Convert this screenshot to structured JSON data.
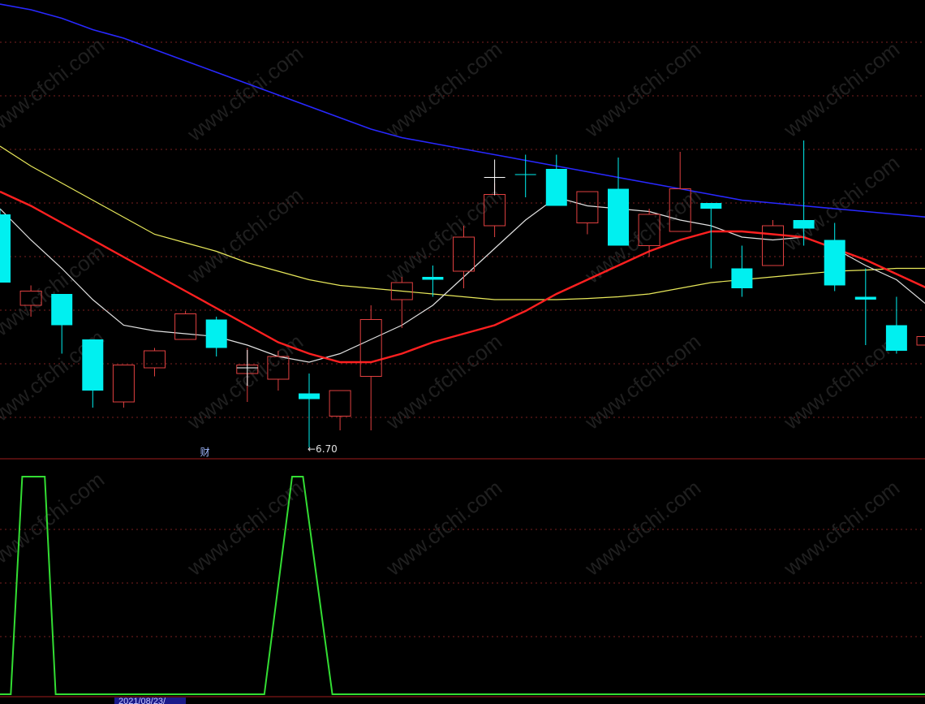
{
  "app": {
    "finance_marker": "财",
    "low_annotation": "←6.70",
    "date_label": "2021/08/23/",
    "watermark": "www.cfchi.com"
  },
  "colors": {
    "background": "#000000",
    "up_candle": "#e04040",
    "down_candle": "#00f0f0",
    "ma_white": "#e0e0e0",
    "ma_yellow": "#e8e85a",
    "ma_red": "#ff2020",
    "ma_blue": "#2828ff",
    "indicator": "#33dd33",
    "grid": "#7a1f1f",
    "divider": "#a01c1c"
  },
  "chart_data": [
    {
      "type": "candlestick",
      "panel": "price",
      "candles": [
        {
          "o": 10.8,
          "c": 9.6,
          "h": 10.9,
          "l": 9.6
        },
        {
          "o": 9.2,
          "c": 9.45,
          "h": 9.55,
          "l": 9.0
        },
        {
          "o": 9.4,
          "c": 8.85,
          "h": 9.4,
          "l": 8.35
        },
        {
          "o": 8.6,
          "c": 7.7,
          "h": 8.6,
          "l": 7.4
        },
        {
          "o": 7.5,
          "c": 8.15,
          "h": 8.15,
          "l": 7.4
        },
        {
          "o": 8.1,
          "c": 8.4,
          "h": 8.45,
          "l": 7.95
        },
        {
          "o": 8.6,
          "c": 9.05,
          "h": 9.1,
          "l": 8.6
        },
        {
          "o": 8.95,
          "c": 8.45,
          "h": 9.0,
          "l": 8.3
        },
        {
          "o": 8.0,
          "c": 8.15,
          "h": 8.45,
          "l": 7.5
        },
        {
          "o": 7.9,
          "c": 8.3,
          "h": 8.4,
          "l": 7.7
        },
        {
          "o": 7.65,
          "c": 7.55,
          "h": 8.0,
          "l": 6.7
        },
        {
          "o": 7.25,
          "c": 7.7,
          "h": 7.7,
          "l": 7.0
        },
        {
          "o": 7.95,
          "c": 8.95,
          "h": 9.2,
          "l": 7.0
        },
        {
          "o": 9.3,
          "c": 9.6,
          "h": 9.7,
          "l": 8.8
        },
        {
          "o": 9.7,
          "c": 9.65,
          "h": 9.9,
          "l": 9.35
        },
        {
          "o": 9.8,
          "c": 10.4,
          "h": 10.6,
          "l": 9.5
        },
        {
          "o": 10.6,
          "c": 11.15,
          "h": 11.35,
          "l": 10.4
        },
        {
          "o": 11.5,
          "c": 11.5,
          "h": 11.85,
          "l": 11.1
        },
        {
          "o": 11.6,
          "c": 10.95,
          "h": 11.85,
          "l": 10.95
        },
        {
          "o": 10.65,
          "c": 11.2,
          "h": 11.2,
          "l": 10.45
        },
        {
          "o": 11.25,
          "c": 10.25,
          "h": 11.8,
          "l": 10.25
        },
        {
          "o": 10.25,
          "c": 10.8,
          "h": 10.9,
          "l": 10.05
        },
        {
          "o": 10.5,
          "c": 11.25,
          "h": 11.9,
          "l": 10.5
        },
        {
          "o": 11.0,
          "c": 10.9,
          "h": 11.0,
          "l": 9.85
        },
        {
          "o": 9.85,
          "c": 9.5,
          "h": 10.25,
          "l": 9.35
        },
        {
          "o": 9.9,
          "c": 10.6,
          "h": 10.7,
          "l": 9.9
        },
        {
          "o": 10.7,
          "c": 10.55,
          "h": 12.1,
          "l": 10.25
        },
        {
          "o": 10.35,
          "c": 9.55,
          "h": 10.65,
          "l": 9.45
        },
        {
          "o": 9.35,
          "c": 9.3,
          "h": 9.85,
          "l": 8.5
        },
        {
          "o": 8.85,
          "c": 8.4,
          "h": 9.35,
          "l": 8.35
        },
        {
          "o": 8.5,
          "c": 8.65,
          "h": 8.85,
          "l": 8.3
        }
      ],
      "ma_white": [
        10.9,
        10.35,
        9.85,
        9.3,
        8.85,
        8.75,
        8.7,
        8.65,
        8.5,
        8.3,
        8.2,
        8.35,
        8.6,
        8.85,
        9.2,
        9.7,
        10.2,
        10.7,
        11.1,
        10.95,
        10.9,
        10.85,
        10.7,
        10.6,
        10.4,
        10.35,
        10.4,
        10.2,
        9.9,
        9.65,
        9.2
      ],
      "ma_yellow": [
        12.0,
        11.65,
        11.35,
        11.05,
        10.75,
        10.45,
        10.3,
        10.15,
        9.95,
        9.8,
        9.65,
        9.55,
        9.5,
        9.45,
        9.4,
        9.35,
        9.3,
        9.3,
        9.3,
        9.32,
        9.35,
        9.4,
        9.5,
        9.6,
        9.65,
        9.7,
        9.75,
        9.8,
        9.82,
        9.85,
        9.85
      ],
      "ma_red": [
        11.2,
        10.95,
        10.65,
        10.35,
        10.05,
        9.75,
        9.45,
        9.15,
        8.85,
        8.55,
        8.35,
        8.2,
        8.2,
        8.35,
        8.55,
        8.7,
        8.85,
        9.1,
        9.4,
        9.65,
        9.9,
        10.15,
        10.35,
        10.5,
        10.5,
        10.45,
        10.4,
        10.2,
        10.0,
        9.75,
        9.5
      ],
      "ma_blue": [
        14.5,
        14.4,
        14.25,
        14.05,
        13.9,
        13.7,
        13.5,
        13.3,
        13.1,
        12.9,
        12.7,
        12.5,
        12.3,
        12.15,
        12.05,
        11.95,
        11.85,
        11.75,
        11.65,
        11.55,
        11.45,
        11.35,
        11.25,
        11.15,
        11.05,
        11.0,
        10.95,
        10.9,
        10.85,
        10.8,
        10.75
      ],
      "crosses": [
        {
          "index": 8,
          "price": 8.1
        },
        {
          "index": 16,
          "price": 11.45
        }
      ],
      "low_marker_index": 10,
      "finance_marker_index": 6
    },
    {
      "type": "line",
      "panel": "indicator",
      "ylim": [
        0,
        1
      ],
      "x": [
        0,
        0.35,
        0.72,
        1.45,
        1.8,
        4.5,
        4.9,
        8.2,
        8.55,
        9.45,
        9.8,
        10.75,
        11.1,
        30.5
      ],
      "values": [
        0,
        0,
        1,
        1,
        0,
        0,
        0,
        0,
        0,
        1,
        1,
        0,
        0,
        0
      ]
    }
  ]
}
